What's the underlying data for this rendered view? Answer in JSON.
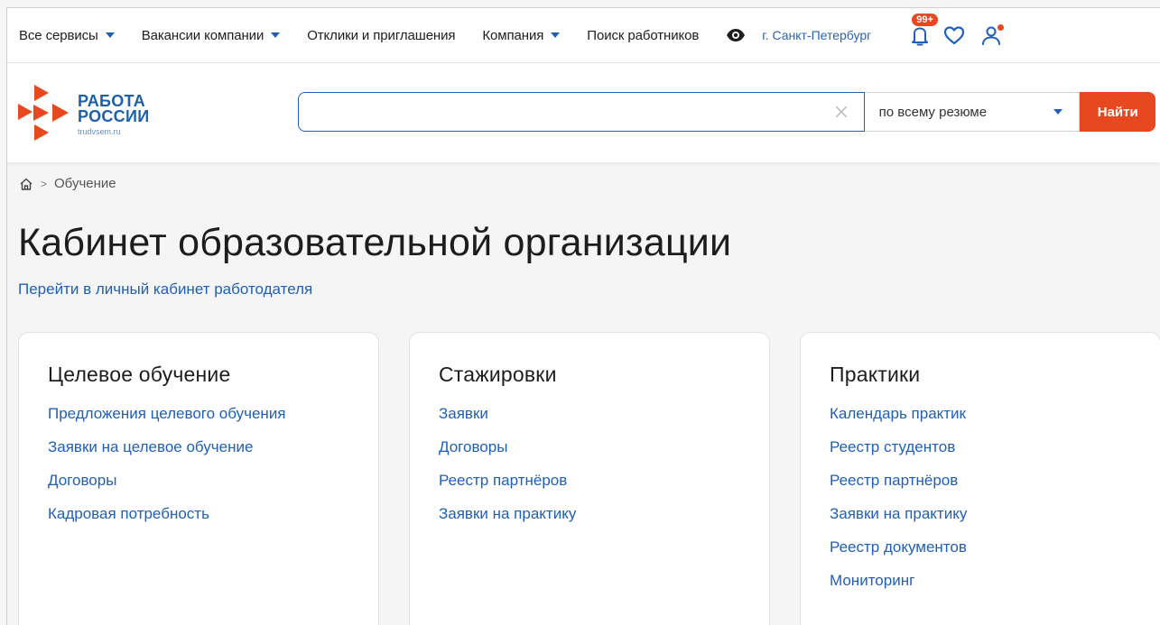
{
  "topnav": {
    "items": [
      {
        "label": "Все сервисы",
        "dropdown": true
      },
      {
        "label": "Вакансии компании",
        "dropdown": true
      },
      {
        "label": "Отклики и приглашения",
        "dropdown": false
      },
      {
        "label": "Компания",
        "dropdown": true
      },
      {
        "label": "Поиск работников",
        "dropdown": false
      }
    ],
    "city": "г. Санкт-Петербург",
    "notifications_badge": "99+"
  },
  "logo": {
    "line1": "РАБОТА",
    "line2": "РОССИИ",
    "sub": "trudvsem.ru"
  },
  "search": {
    "value": "",
    "placeholder": "",
    "scope": "по всему резюме",
    "button": "Найти"
  },
  "breadcrumb": {
    "separator": ">",
    "current": "Обучение"
  },
  "page": {
    "title": "Кабинет образовательной организации",
    "employer_link": "Перейти в личный кабинет работодателя"
  },
  "cards": [
    {
      "title": "Целевое обучение",
      "links": [
        "Предложения целевого обучения",
        "Заявки на целевое обучение",
        "Договоры",
        "Кадровая потребность"
      ]
    },
    {
      "title": "Стажировки",
      "links": [
        "Заявки",
        "Договоры",
        "Реестр партнёров",
        "Заявки на практику"
      ]
    },
    {
      "title": "Практики",
      "links": [
        "Календарь практик",
        "Реестр студентов",
        "Реестр партнёров",
        "Заявки на практику",
        "Реестр документов",
        "Мониторинг"
      ]
    }
  ],
  "colors": {
    "accent": "#1f5fb8",
    "brand_orange": "#e8481f",
    "background": "#f5f5f5"
  },
  "icons": {
    "eye": "eye-icon",
    "bell": "bell-icon",
    "heart": "heart-icon",
    "user": "user-icon",
    "home": "home-icon",
    "clear": "close-icon"
  }
}
